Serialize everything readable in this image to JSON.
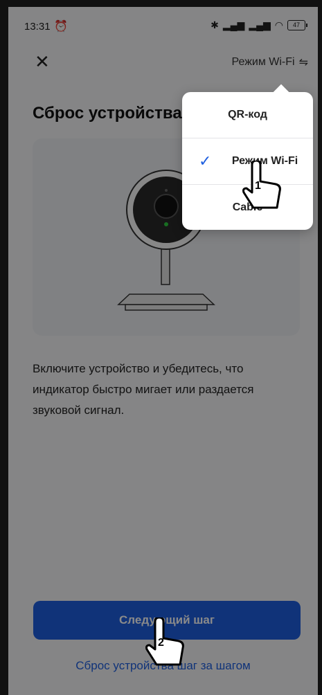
{
  "status_bar": {
    "time": "13:31",
    "alarm_icon": "alarm-icon",
    "bluetooth_icon": "bluetooth-icon",
    "signal_icons": [
      "signal-icon",
      "signal-icon"
    ],
    "wifi_icon": "wifi-icon",
    "battery": "47"
  },
  "header": {
    "close_icon": "close-icon",
    "mode_label": "Режим Wi-Fi",
    "switch_icon": "swap-arrows-icon"
  },
  "page": {
    "title": "Сброс устройства",
    "description": "Включите устройство и убедитесь, что индикатор быстро мигает или раздается звуковой сигнал.",
    "next_button": "Следующий шаг",
    "reset_link": "Сброс устройства шаг за шагом"
  },
  "menu": {
    "items": [
      {
        "label": "QR-код",
        "selected": false
      },
      {
        "label": "Режим Wi-Fi",
        "selected": true
      },
      {
        "label": "Cable",
        "selected": false
      }
    ]
  },
  "annotations": {
    "step1": "1",
    "step2": "2"
  },
  "colors": {
    "accent": "#1e5fe0",
    "overlay": "#000000"
  }
}
